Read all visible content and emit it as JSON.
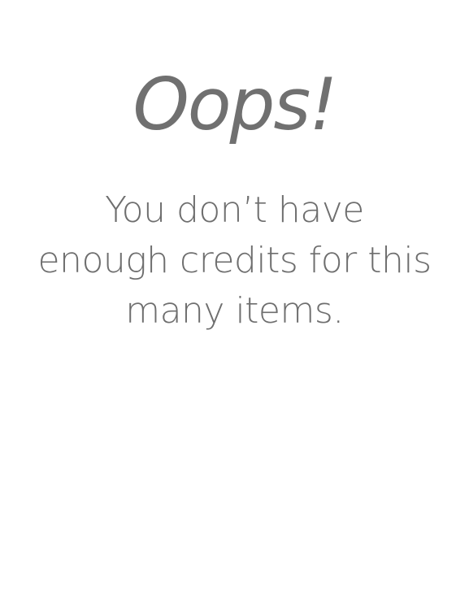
{
  "dialog": {
    "title": "Oops!",
    "message_lines": [
      "You don’t have",
      "enough credits for this",
      "many items."
    ]
  },
  "colors": {
    "background": "#ffffff",
    "text": "#707070"
  }
}
